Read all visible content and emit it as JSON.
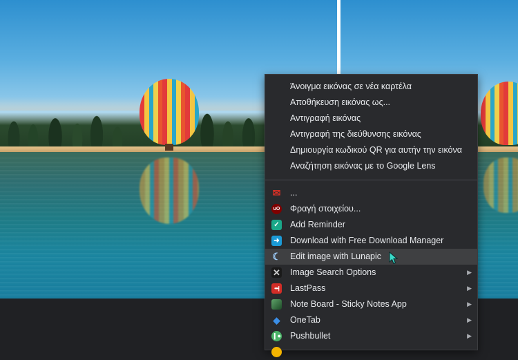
{
  "context_menu": {
    "top_items": [
      {
        "label": "Άνοιγμα εικόνας σε νέα καρτέλα"
      },
      {
        "label": "Αποθήκευση εικόνας ως..."
      },
      {
        "label": "Αντιγραφή εικόνας"
      },
      {
        "label": "Αντιγραφή της διεύθυνσης εικόνας"
      },
      {
        "label": "Δημιουργία κωδικού QR για αυτήν την εικόνα"
      },
      {
        "label": "Αναζήτηση εικόνας με το Google Lens"
      }
    ],
    "extension_items": [
      {
        "label": "...",
        "icon": "mail-extension-icon",
        "color": "#d93025",
        "submenu": false
      },
      {
        "label": "Φραγή στοιχείου...",
        "icon": "ublock-origin-icon",
        "color": "#800000",
        "submenu": false
      },
      {
        "label": "Add Reminder",
        "icon": "reminder-check-icon",
        "color": "#1aa889",
        "submenu": false
      },
      {
        "label": "Download with Free Download Manager",
        "icon": "fdm-download-icon",
        "color": "#1b9ad6",
        "submenu": false
      },
      {
        "label": "Edit image with Lunapic",
        "icon": "lunapic-moon-icon",
        "color": "#3b8fe8",
        "submenu": false,
        "highlighted": true
      },
      {
        "label": "Image Search Options",
        "icon": "image-search-icon",
        "color": "#333333",
        "submenu": true
      },
      {
        "label": "LastPass",
        "icon": "lastpass-icon",
        "color": "#d32d27",
        "submenu": true
      },
      {
        "label": "Note Board - Sticky Notes App",
        "icon": "note-board-icon",
        "color": "#2f6a3a",
        "submenu": true
      },
      {
        "label": "OneTab",
        "icon": "onetab-icon",
        "color": "#2e7bd6",
        "submenu": true
      },
      {
        "label": "Pushbullet",
        "icon": "pushbullet-icon",
        "color": "#4ab367",
        "submenu": true
      }
    ]
  }
}
